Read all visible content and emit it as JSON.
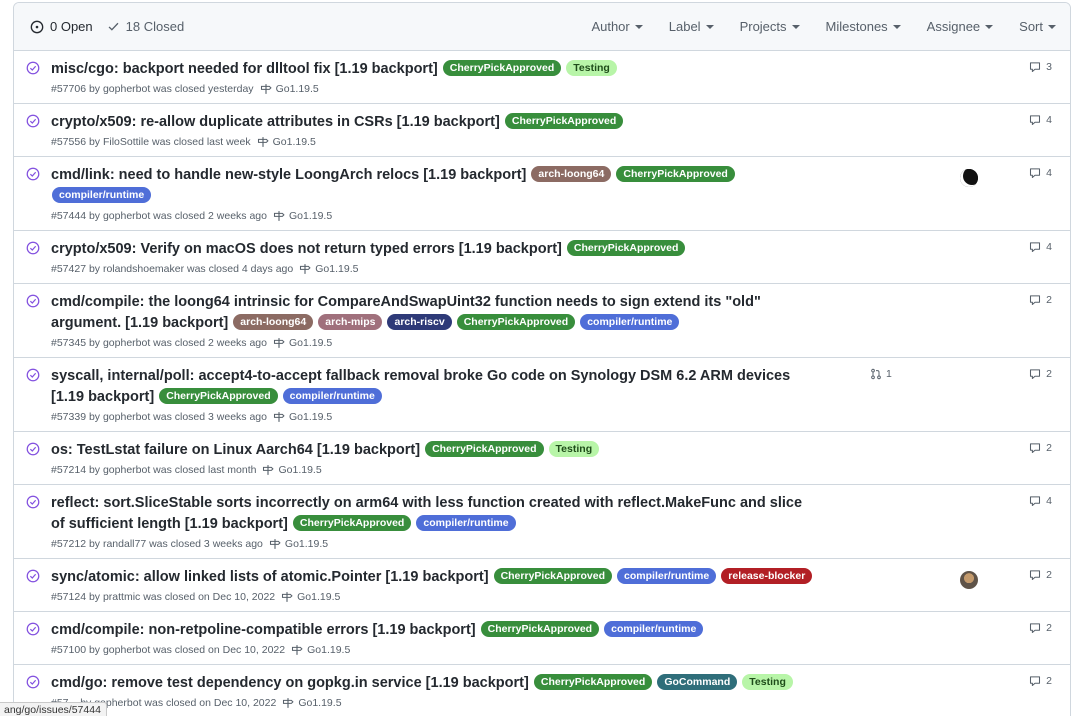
{
  "header": {
    "open_label": "0 Open",
    "closed_label": "18 Closed",
    "filters": [
      "Author",
      "Label",
      "Projects",
      "Milestones",
      "Assignee",
      "Sort"
    ]
  },
  "colors": {
    "closed_purple": "#8250df",
    "CherryPickApproved": "#388e3c",
    "Testing": "#b8f5a8",
    "arch-loong64": "#8c6b63",
    "compiler/runtime": "#4f6ed8",
    "arch-mips": "#a0707c",
    "arch-riscv": "#2e3a78",
    "release-blocker": "#b21f25",
    "GoCommand": "#2f6e7a"
  },
  "issues": [
    {
      "title": "misc/cgo: backport needed for dlltool fix [1.19 backport]",
      "labels": [
        "CherryPickApproved",
        "Testing"
      ],
      "meta": "#57706 by gopherbot was closed yesterday",
      "milestone": "Go1.19.5",
      "comments": "3"
    },
    {
      "title": "crypto/x509: re-allow duplicate attributes in CSRs [1.19 backport]",
      "labels": [
        "CherryPickApproved"
      ],
      "meta": "#57556 by FiloSottile was closed last week",
      "milestone": "Go1.19.5",
      "comments": "4"
    },
    {
      "title": "cmd/link: need to handle new-style LoongArch relocs [1.19 backport]",
      "labels": [
        "arch-loong64",
        "CherryPickApproved",
        "compiler/runtime"
      ],
      "meta": "#57444 by gopherbot was closed 2 weeks ago",
      "milestone": "Go1.19.5",
      "comments": "4",
      "assignee": "black-gopher-avatar"
    },
    {
      "title": "crypto/x509: Verify on macOS does not return typed errors [1.19 backport]",
      "labels": [
        "CherryPickApproved"
      ],
      "meta": "#57427 by rolandshoemaker was closed 4 days ago",
      "milestone": "Go1.19.5",
      "comments": "4"
    },
    {
      "title": "cmd/compile: the loong64 intrinsic for CompareAndSwapUint32 function needs to sign extend its \"old\" argument. [1.19 backport]",
      "labels": [
        "arch-loong64",
        "arch-mips",
        "arch-riscv",
        "CherryPickApproved",
        "compiler/runtime"
      ],
      "meta": "#57345 by gopherbot was closed 2 weeks ago",
      "milestone": "Go1.19.5",
      "comments": "2"
    },
    {
      "title": "syscall, internal/poll: accept4-to-accept fallback removal broke Go code on Synology DSM 6.2 ARM devices [1.19 backport]",
      "labels": [
        "CherryPickApproved",
        "compiler/runtime"
      ],
      "meta": "#57339 by gopherbot was closed 3 weeks ago",
      "milestone": "Go1.19.5",
      "comments": "2",
      "linked_prs": "1"
    },
    {
      "title": "os: TestLstat failure on Linux Aarch64 [1.19 backport]",
      "labels": [
        "CherryPickApproved",
        "Testing"
      ],
      "meta": "#57214 by gopherbot was closed last month",
      "milestone": "Go1.19.5",
      "comments": "2"
    },
    {
      "title": "reflect: sort.SliceStable sorts incorrectly on arm64 with less function created with reflect.MakeFunc and slice of sufficient length [1.19 backport]",
      "labels": [
        "CherryPickApproved",
        "compiler/runtime"
      ],
      "meta": "#57212 by randall77 was closed 3 weeks ago",
      "milestone": "Go1.19.5",
      "comments": "4"
    },
    {
      "title": "sync/atomic: allow linked lists of atomic.Pointer [1.19 backport]",
      "labels": [
        "CherryPickApproved",
        "compiler/runtime",
        "release-blocker"
      ],
      "meta": "#57124 by prattmic was closed on Dec 10, 2022",
      "milestone": "Go1.19.5",
      "comments": "2",
      "assignee": "photo-avatar"
    },
    {
      "title": "cmd/compile: non-retpoline-compatible errors [1.19 backport]",
      "labels": [
        "CherryPickApproved",
        "compiler/runtime"
      ],
      "meta": "#57100 by gopherbot was closed on Dec 10, 2022",
      "milestone": "Go1.19.5",
      "comments": "2"
    },
    {
      "title": "cmd/go: remove test dependency on gopkg.in service [1.19 backport]",
      "labels": [
        "CherryPickApproved",
        "GoCommand",
        "Testing"
      ],
      "meta": "#57... by gopherbot was closed on Dec 10, 2022",
      "milestone": "Go1.19.5",
      "comments": "2"
    }
  ],
  "statusbar": {
    "url": "ang/go/issues/57444"
  }
}
